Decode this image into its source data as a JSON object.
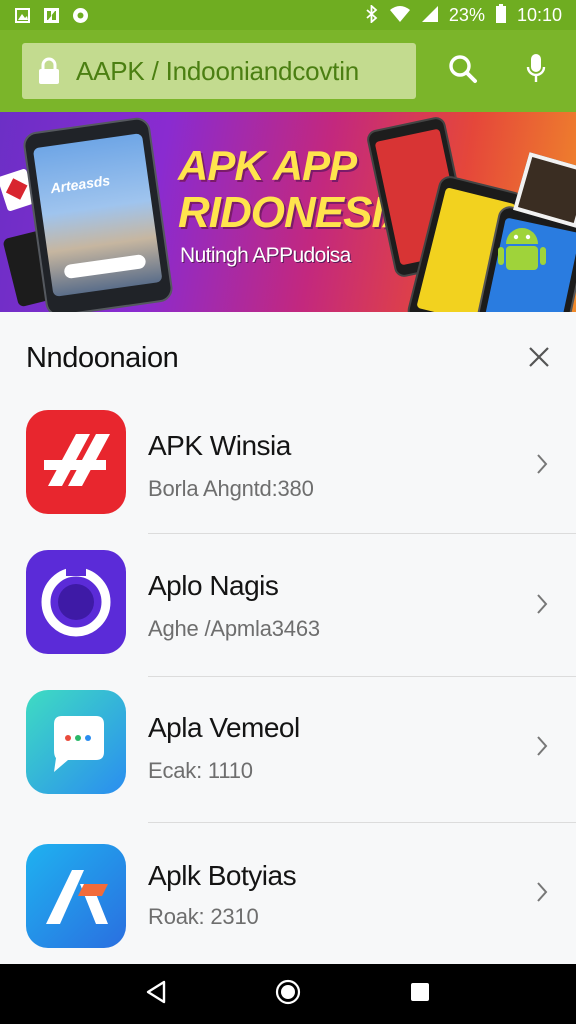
{
  "status_bar": {
    "left_icons": [
      "gallery-icon",
      "app-store-icon",
      "notification-dot-icon"
    ],
    "right_icons": [
      "bluetooth-icon",
      "wifi-icon",
      "signal-icon",
      "battery-icon"
    ],
    "battery": "23%",
    "time": "10:10"
  },
  "toolbar": {
    "url": "AAPK / Indooniandcovtin",
    "icons": [
      "lock-icon",
      "search-icon",
      "mic-icon"
    ]
  },
  "banner": {
    "title_line1": "APK APP",
    "title_line2": "RIDONESIA",
    "subtitle": "Nutingh APPudoisa",
    "phone_screen_title": "Arteasds"
  },
  "panel": {
    "title": "Nndoonaion",
    "close_icon": "close-icon"
  },
  "apps": [
    {
      "name": "APK Winsia",
      "meta": "Borla  Ahgntd:380",
      "icon": "app-red-logo-icon",
      "color": "#e8262e"
    },
    {
      "name": "Aplo Nagis",
      "meta": "Aghe  /Apmla3463",
      "icon": "app-purple-ring-icon",
      "color": "#5b2bd8"
    },
    {
      "name": "Apla Vemeol",
      "meta": "Ecak: 1110",
      "icon": "app-chat-bubble-icon",
      "color": "#2bc3d6"
    },
    {
      "name": "Aplk Botyias",
      "meta": "Roak: 2310",
      "icon": "app-a-logo-icon",
      "color": "#2a8df0"
    }
  ],
  "nav": {
    "icons": [
      "back-icon",
      "home-icon",
      "recents-icon"
    ]
  },
  "colors": {
    "status_bar": "#6fad21",
    "toolbar": "#7bb52a",
    "url_bar": "#c3db8f",
    "url_text": "#4b7f12",
    "accent_yellow": "#ffe44d"
  }
}
